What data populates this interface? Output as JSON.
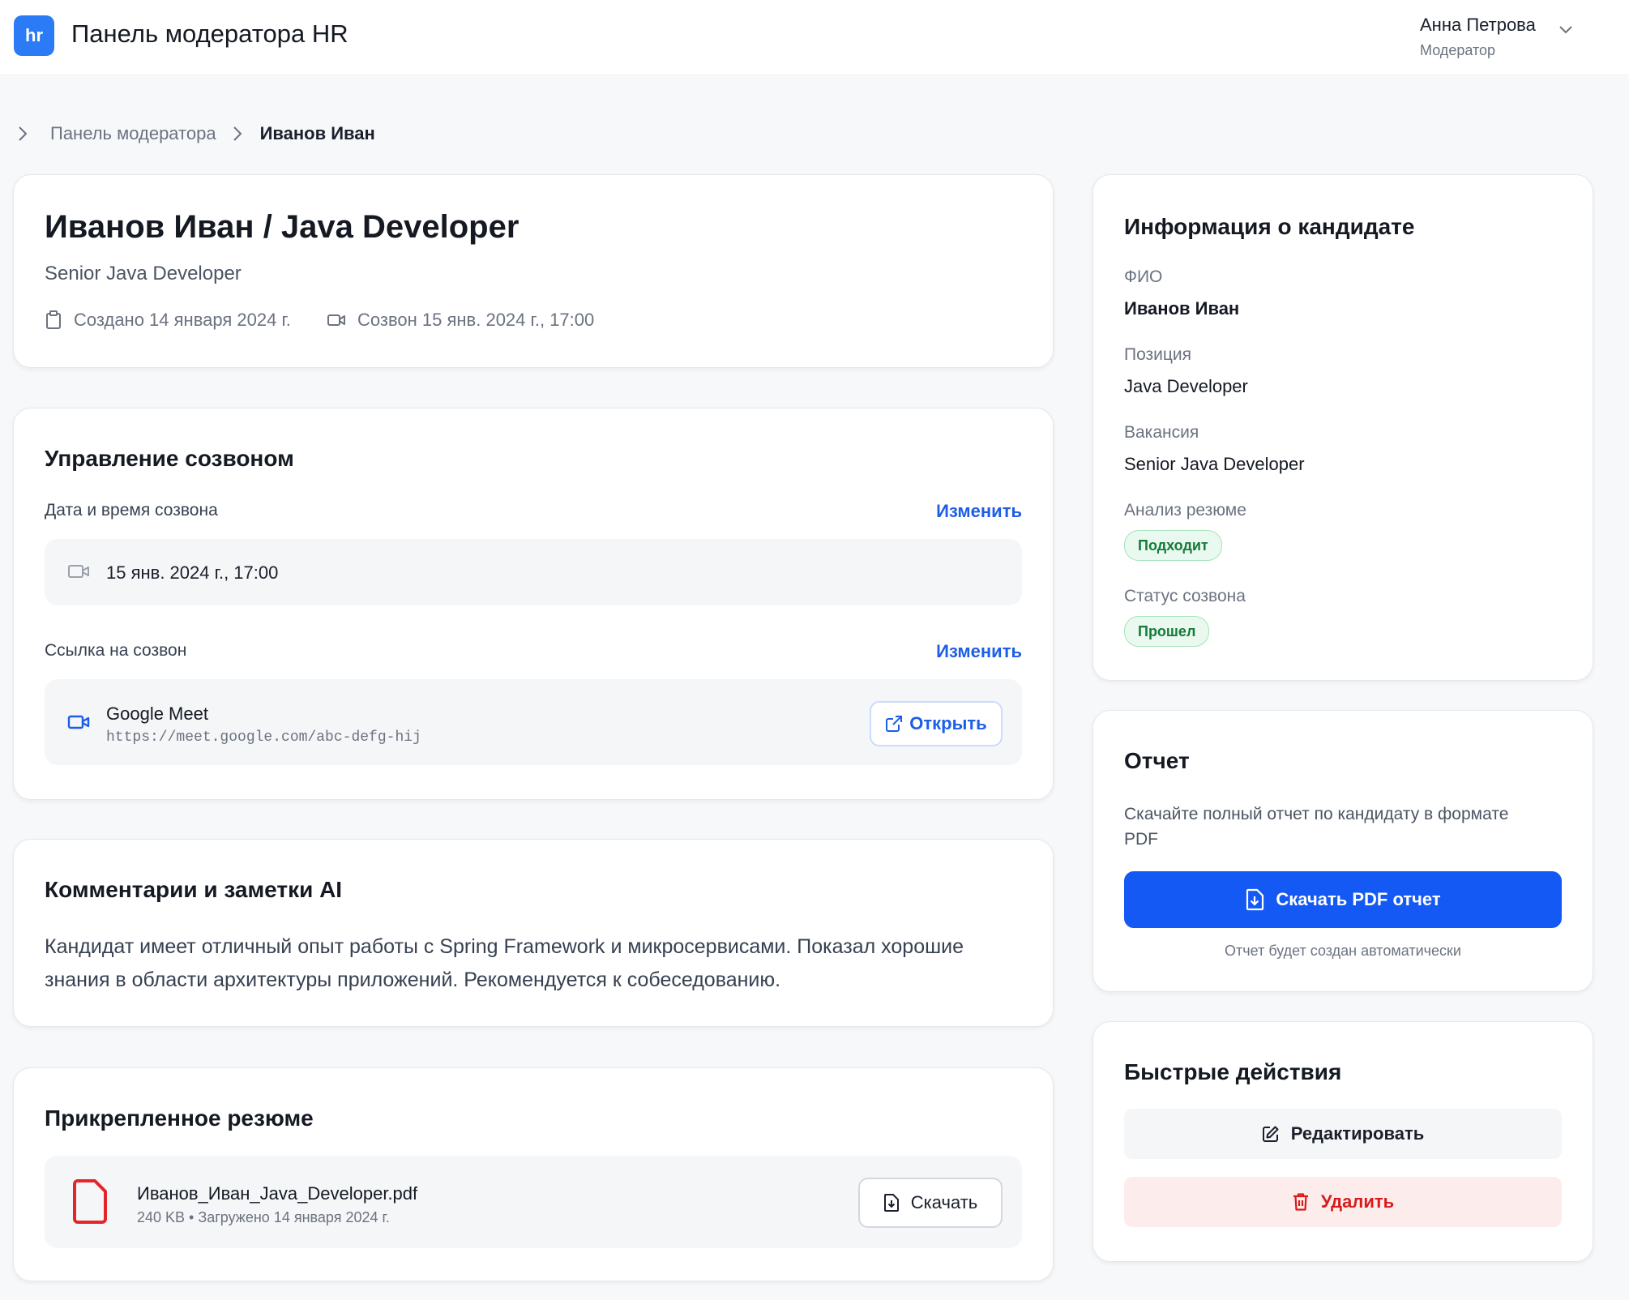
{
  "app": {
    "logo_text": "hr",
    "title": "Панель модератора HR"
  },
  "user": {
    "name": "Анна Петрова",
    "role": "Модератор"
  },
  "breadcrumb": {
    "parent": "Панель модератора",
    "current": "Иванов Иван"
  },
  "header": {
    "title": "Иванов Иван / Java Developer",
    "subtitle": "Senior Java Developer",
    "created": "Создано 14 января 2024 г.",
    "call": "Созвон 15 янв. 2024 г., 17:00"
  },
  "call_management": {
    "title": "Управление созвоном",
    "datetime_label": "Дата и время созвона",
    "edit_label": "Изменить",
    "datetime_value": "15 янв. 2024 г., 17:00",
    "link_label": "Ссылка на созвон",
    "link_edit_label": "Изменить",
    "service_name": "Google Meet",
    "url": "https://meet.google.com/abc-defg-hij",
    "open_label": "Открыть"
  },
  "comments": {
    "title": "Комментарии и заметки AI",
    "text": "Кандидат имеет отличный опыт работы с Spring Framework и микросервисами. Показал хорошие знания в области архитектуры приложений. Рекомендуется к собеседованию."
  },
  "resume": {
    "title": "Прикрепленное резюме",
    "filename": "Иванов_Иван_Java_Developer.pdf",
    "meta": "240 KB • Загружено 14 января 2024 г.",
    "download_label": "Скачать"
  },
  "candidate_info": {
    "title": "Информация о кандидате",
    "fio_label": "ФИО",
    "fio_value": "Иванов Иван",
    "position_label": "Позиция",
    "position_value": "Java Developer",
    "vacancy_label": "Вакансия",
    "vacancy_value": "Senior Java Developer",
    "resume_analysis_label": "Анализ резюме",
    "resume_analysis_badge": "Подходит",
    "call_status_label": "Статус созвона",
    "call_status_badge": "Прошел"
  },
  "report": {
    "title": "Отчет",
    "description": "Скачайте полный отчет по кандидату в формате PDF",
    "button_label": "Скачать PDF отчет",
    "note": "Отчет будет создан автоматически"
  },
  "quick_actions": {
    "title": "Быстрые действия",
    "edit_label": "Редактировать",
    "delete_label": "Удалить"
  },
  "colors": {
    "accent": "#1559f5",
    "link": "#1d5ee6",
    "success_bg": "#e9f9ef",
    "success_text": "#157a3a",
    "danger_bg": "#fdecec",
    "danger_text": "#d81b1b"
  }
}
